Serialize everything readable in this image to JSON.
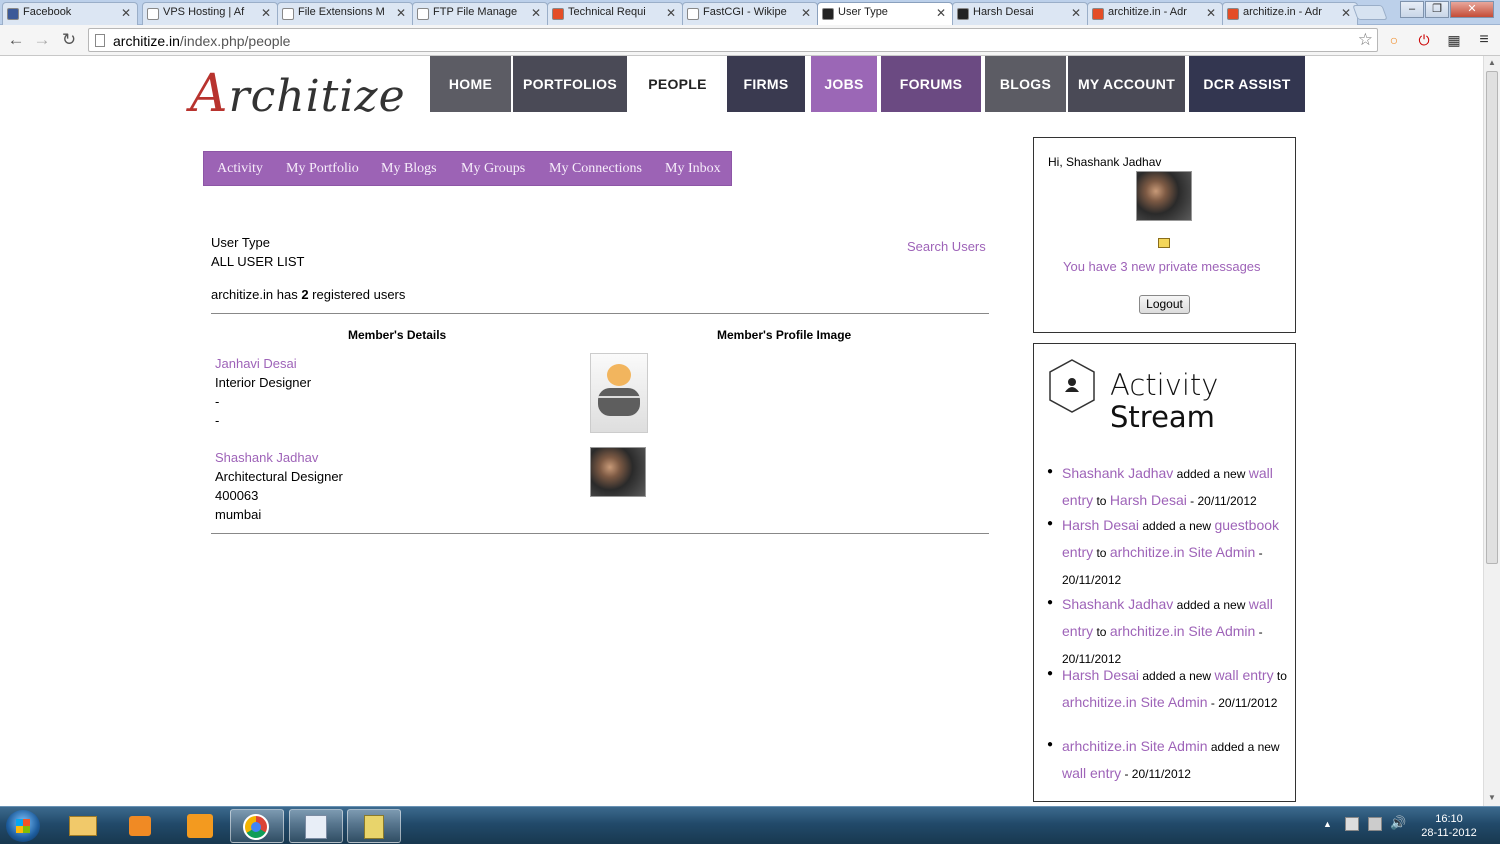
{
  "browser": {
    "tabs": [
      {
        "title": "Facebook",
        "icon": "facebook-icon",
        "color": "#3b5998"
      },
      {
        "title": "VPS Hosting | Af",
        "icon": "page-icon",
        "color": "#ffffff"
      },
      {
        "title": "File Extensions M",
        "icon": "page-icon",
        "color": "#ffffff"
      },
      {
        "title": "FTP File Manage",
        "icon": "page-icon",
        "color": "#ffffff"
      },
      {
        "title": "Technical Requi",
        "icon": "joomla-icon",
        "color": "#e44d26"
      },
      {
        "title": "FastCGI - Wikipe",
        "icon": "wikipedia-icon",
        "color": "#ffffff"
      },
      {
        "title": "User Type",
        "icon": "architize-icon",
        "color": "#222222"
      },
      {
        "title": "Harsh Desai",
        "icon": "architize-icon",
        "color": "#222222"
      },
      {
        "title": "architize.in - Adr",
        "icon": "joomla-icon",
        "color": "#e44d26"
      },
      {
        "title": "architize.in - Adr",
        "icon": "joomla-icon",
        "color": "#e44d26"
      }
    ],
    "url_host": "architize.in",
    "url_path": "/index.php/people"
  },
  "site": {
    "logo_text": "rchitize",
    "logo_letter": "A",
    "main_nav": [
      {
        "label": "HOME",
        "color": "#5c5c64"
      },
      {
        "label": "PORTFOLIOS",
        "color": "#4a4a56"
      },
      {
        "label": "PEOPLE",
        "color": "#ffffff"
      },
      {
        "label": "FIRMS",
        "color": "#3a3a50"
      },
      {
        "label": "JOBS",
        "color": "#9b67b6"
      },
      {
        "label": "FORUMS",
        "color": "#6b4a82"
      },
      {
        "label": "BLOGS",
        "color": "#5c5c64"
      },
      {
        "label": "MY ACCOUNT",
        "color": "#4a4a56"
      },
      {
        "label": "DCR ASSIST",
        "color": "#333650"
      }
    ],
    "sub_nav": [
      "Activity",
      "My Portfolio",
      "My Blogs",
      "My Groups",
      "My Connections",
      "My Inbox"
    ]
  },
  "content": {
    "heading": "User Type",
    "subheading": "ALL USER LIST",
    "search_users": "Search Users",
    "registered_prefix": "architize.in has ",
    "registered_count": "2",
    "registered_suffix": " registered users",
    "col_details": "Member's Details",
    "col_image": "Member's Profile Image",
    "members": [
      {
        "name": "Janhavi Desai",
        "role": "Interior Designer",
        "line3": "-",
        "line4": "-",
        "avatar": "default-avatar-icon"
      },
      {
        "name": "Shashank Jadhav",
        "role": "Architectural Designer",
        "line3": "400063",
        "line4": "mumbai",
        "avatar": "user-photo"
      }
    ]
  },
  "sidebar": {
    "greeting": "Hi, Shashank Jadhav",
    "messages": "You have 3 new private messages",
    "logout": "Logout",
    "activity_title_1": "Activity",
    "activity_title_2": "Stream",
    "activity": [
      {
        "a": "Shashank Jadhav",
        "b": " added a new ",
        "c": "wall entry",
        "d": " to ",
        "e": "Harsh Desai",
        "f": " - 20/11/2012"
      },
      {
        "a": "Harsh Desai",
        "b": " added a new ",
        "c": "guestbook entry",
        "d": " to ",
        "e": "arhchitize.in Site Admin",
        "f": " - 20/11/2012"
      },
      {
        "a": "Shashank Jadhav",
        "b": " added a new ",
        "c": "wall entry",
        "d": " to ",
        "e": "arhchitize.in Site Admin",
        "f": " - 20/11/2012"
      },
      {
        "a": "Harsh Desai",
        "b": " added a new ",
        "c": "wall entry",
        "d": " to ",
        "e": "arhchitize.in Site Admin",
        "f": " - 20/11/2012"
      },
      {
        "a": "arhchitize.in Site Admin",
        "b": " added a new ",
        "c": "wall entry",
        "d": "",
        "e": "",
        "f": " - 20/11/2012"
      }
    ]
  },
  "taskbar": {
    "time": "16:10",
    "date": "28-11-2012"
  },
  "colors": {
    "accent": "#9c63b5",
    "link": "#9e63b8"
  }
}
